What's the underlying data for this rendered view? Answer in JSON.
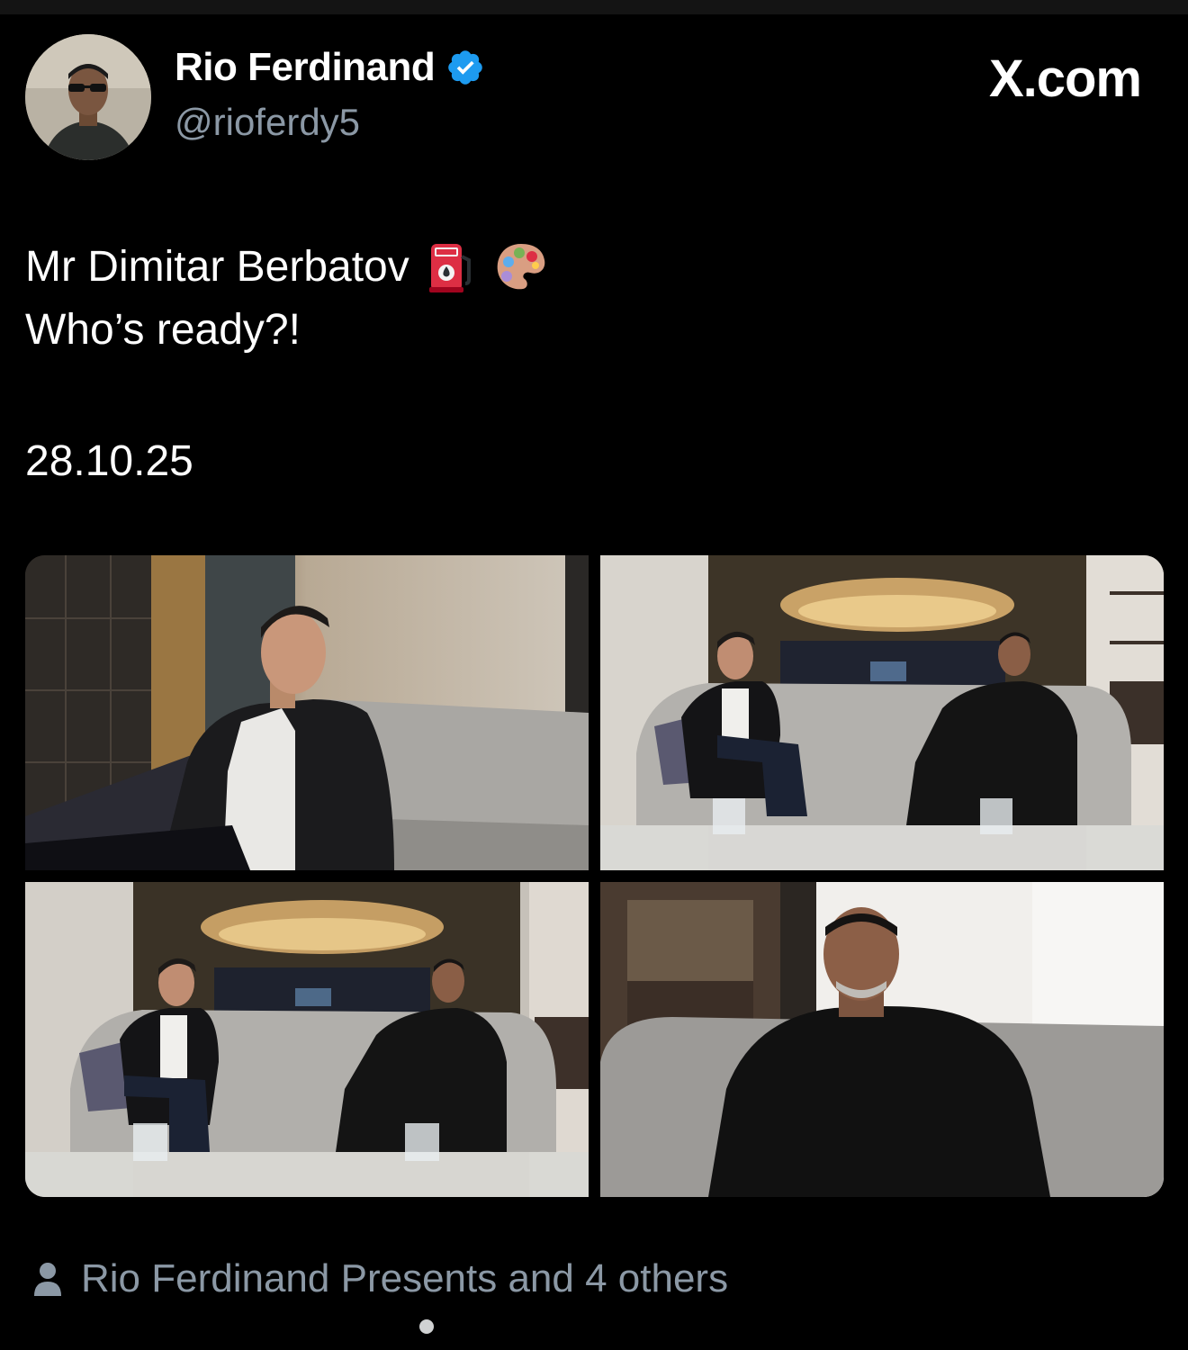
{
  "header": {
    "display_name": "Rio Ferdinand",
    "handle": "@rioferdy5",
    "verified": true,
    "verified_color": "#1d9bf0",
    "brand": "X.com",
    "brand_icon": "x-logo-icon"
  },
  "tweet": {
    "line1": "Mr Dimitar Berbatov",
    "line1_emojis": [
      "fuel-pump-icon",
      "artist-palette-icon"
    ],
    "line2": "Who’s ready?!",
    "date": "28.10.25"
  },
  "media": {
    "photos": [
      {
        "label": "photo-1",
        "subject": "Berbatov on sofa"
      },
      {
        "label": "photo-2",
        "subject": "Berbatov and Ferdinand seated under chandelier"
      },
      {
        "label": "photo-3",
        "subject": "Berbatov and Ferdinand wide shot"
      },
      {
        "label": "photo-4",
        "subject": "Ferdinand smiling on sofa"
      }
    ]
  },
  "tagged": {
    "icon": "person-icon",
    "text": "Rio Ferdinand Presents and 4 others"
  },
  "colors": {
    "background": "#000000",
    "primary_text": "#ffffff",
    "secondary_text": "#8b98a5"
  }
}
